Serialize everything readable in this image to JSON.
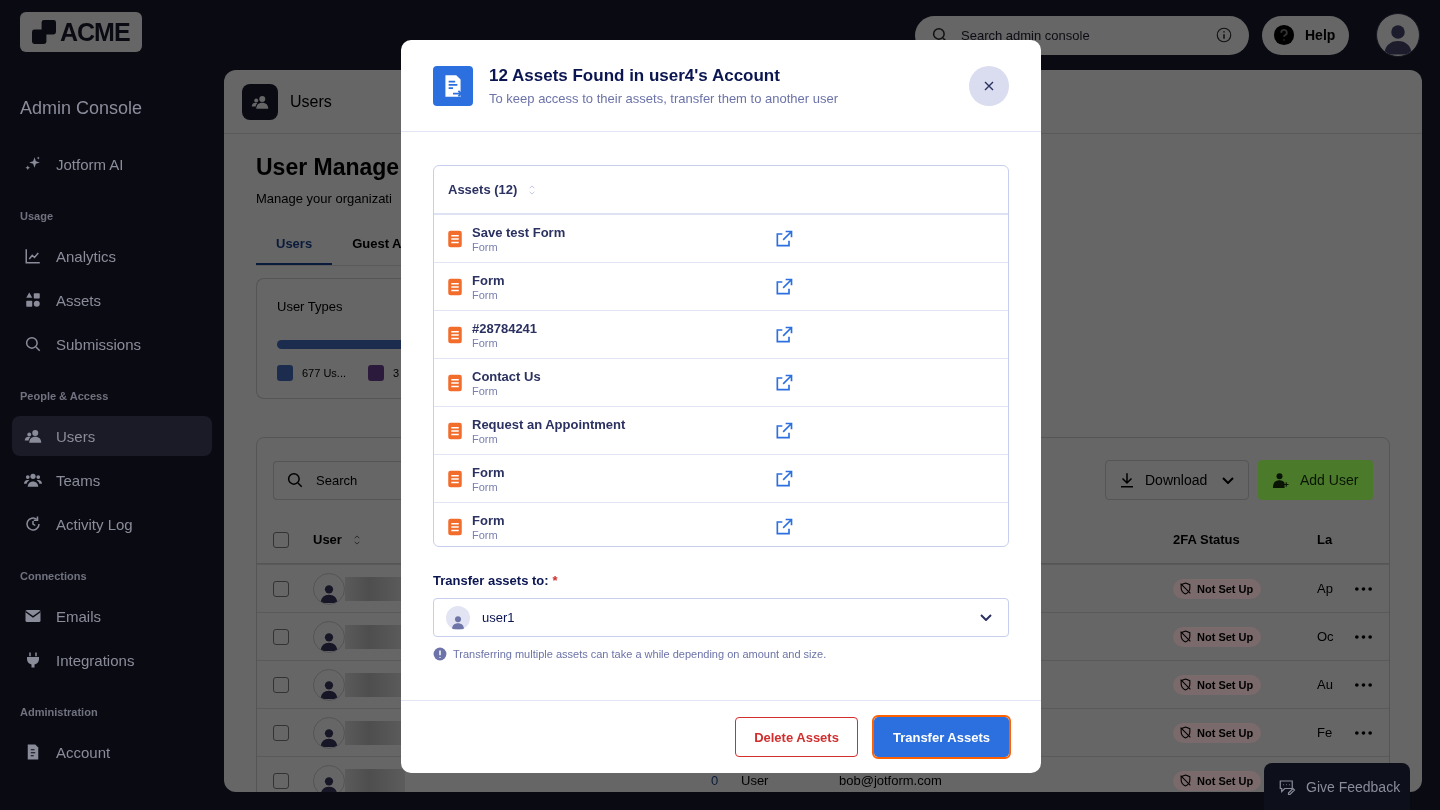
{
  "top_bar": {
    "logo": "ACME",
    "search": {
      "placeholder": "Search admin console"
    },
    "help": "Help"
  },
  "sidebar": {
    "title": "Admin Console",
    "sections": [
      {
        "items": [
          {
            "label": "Jotform AI",
            "selected": false
          }
        ]
      },
      {
        "heading": "Usage",
        "items": [
          {
            "label": "Analytics",
            "selected": false
          },
          {
            "label": "Assets",
            "selected": false
          },
          {
            "label": "Submissions",
            "selected": false
          }
        ]
      },
      {
        "heading": "People & Access",
        "items": [
          {
            "label": "Users",
            "selected": true
          },
          {
            "label": "Teams",
            "selected": false
          },
          {
            "label": "Activity Log",
            "selected": false
          }
        ]
      },
      {
        "heading": "Connections",
        "items": [
          {
            "label": "Emails",
            "selected": false
          },
          {
            "label": "Integrations",
            "selected": false
          }
        ]
      },
      {
        "heading": "Administration",
        "items": [
          {
            "label": "Account",
            "selected": false
          }
        ]
      }
    ]
  },
  "main": {
    "header": {
      "title": "Users"
    },
    "page_title": "User Manage",
    "subtitle": "Manage your organizati",
    "tabs": [
      {
        "label": "Users",
        "selected": true
      },
      {
        "label": "Guest A",
        "selected": false
      }
    ],
    "user_types": {
      "title": "User Types",
      "legend": [
        {
          "label": "677 Us...",
          "color": "#1b2c4e"
        },
        {
          "label": "3",
          "color": "#2c1a3c"
        }
      ]
    },
    "table": {
      "search": {
        "placeholder": "Search"
      },
      "download": "Download",
      "add_user": "Add User",
      "columns": [
        "User",
        "2FA Status",
        "La"
      ],
      "header_checked": false,
      "rows": [
        {
          "checked": false,
          "status": "Not Set Up",
          "last": "Ap"
        },
        {
          "checked": false,
          "status": "Not Set Up",
          "last": "Oc"
        },
        {
          "checked": false,
          "status": "Not Set Up",
          "last": "Au"
        },
        {
          "checked": false,
          "status": "Not Set Up",
          "last": "Fe"
        },
        {
          "checked": false,
          "column_3": "0",
          "type": "User",
          "email": "bob@jotform.com",
          "status": "Not Set Up"
        }
      ]
    }
  },
  "modal": {
    "title": "12 Assets Found in user4's Account",
    "subtitle": "To keep access to their assets, transfer them to another user",
    "assets": {
      "column": "Assets (12)",
      "rows": [
        {
          "name": "Save test Form",
          "type": "Form"
        },
        {
          "name": "Form",
          "type": "Form"
        },
        {
          "name": "#28784241",
          "type": "Form"
        },
        {
          "name": "Contact Us",
          "type": "Form"
        },
        {
          "name": "Request an Appointment",
          "type": "Form"
        },
        {
          "name": "Form",
          "type": "Form"
        },
        {
          "name": "Form",
          "type": "Form"
        }
      ]
    },
    "transfer": {
      "label": "Transfer assets to:",
      "required_mark": "*",
      "value": "user1",
      "note": "Transferring multiple assets can take a while depending on amount and size."
    },
    "buttons": [
      {
        "label": "Delete Assets",
        "kind": "danger",
        "focused": false
      },
      {
        "label": "Transfer Assets",
        "kind": "primary",
        "focused": true
      }
    ]
  },
  "feedback": "Give Feedback"
}
